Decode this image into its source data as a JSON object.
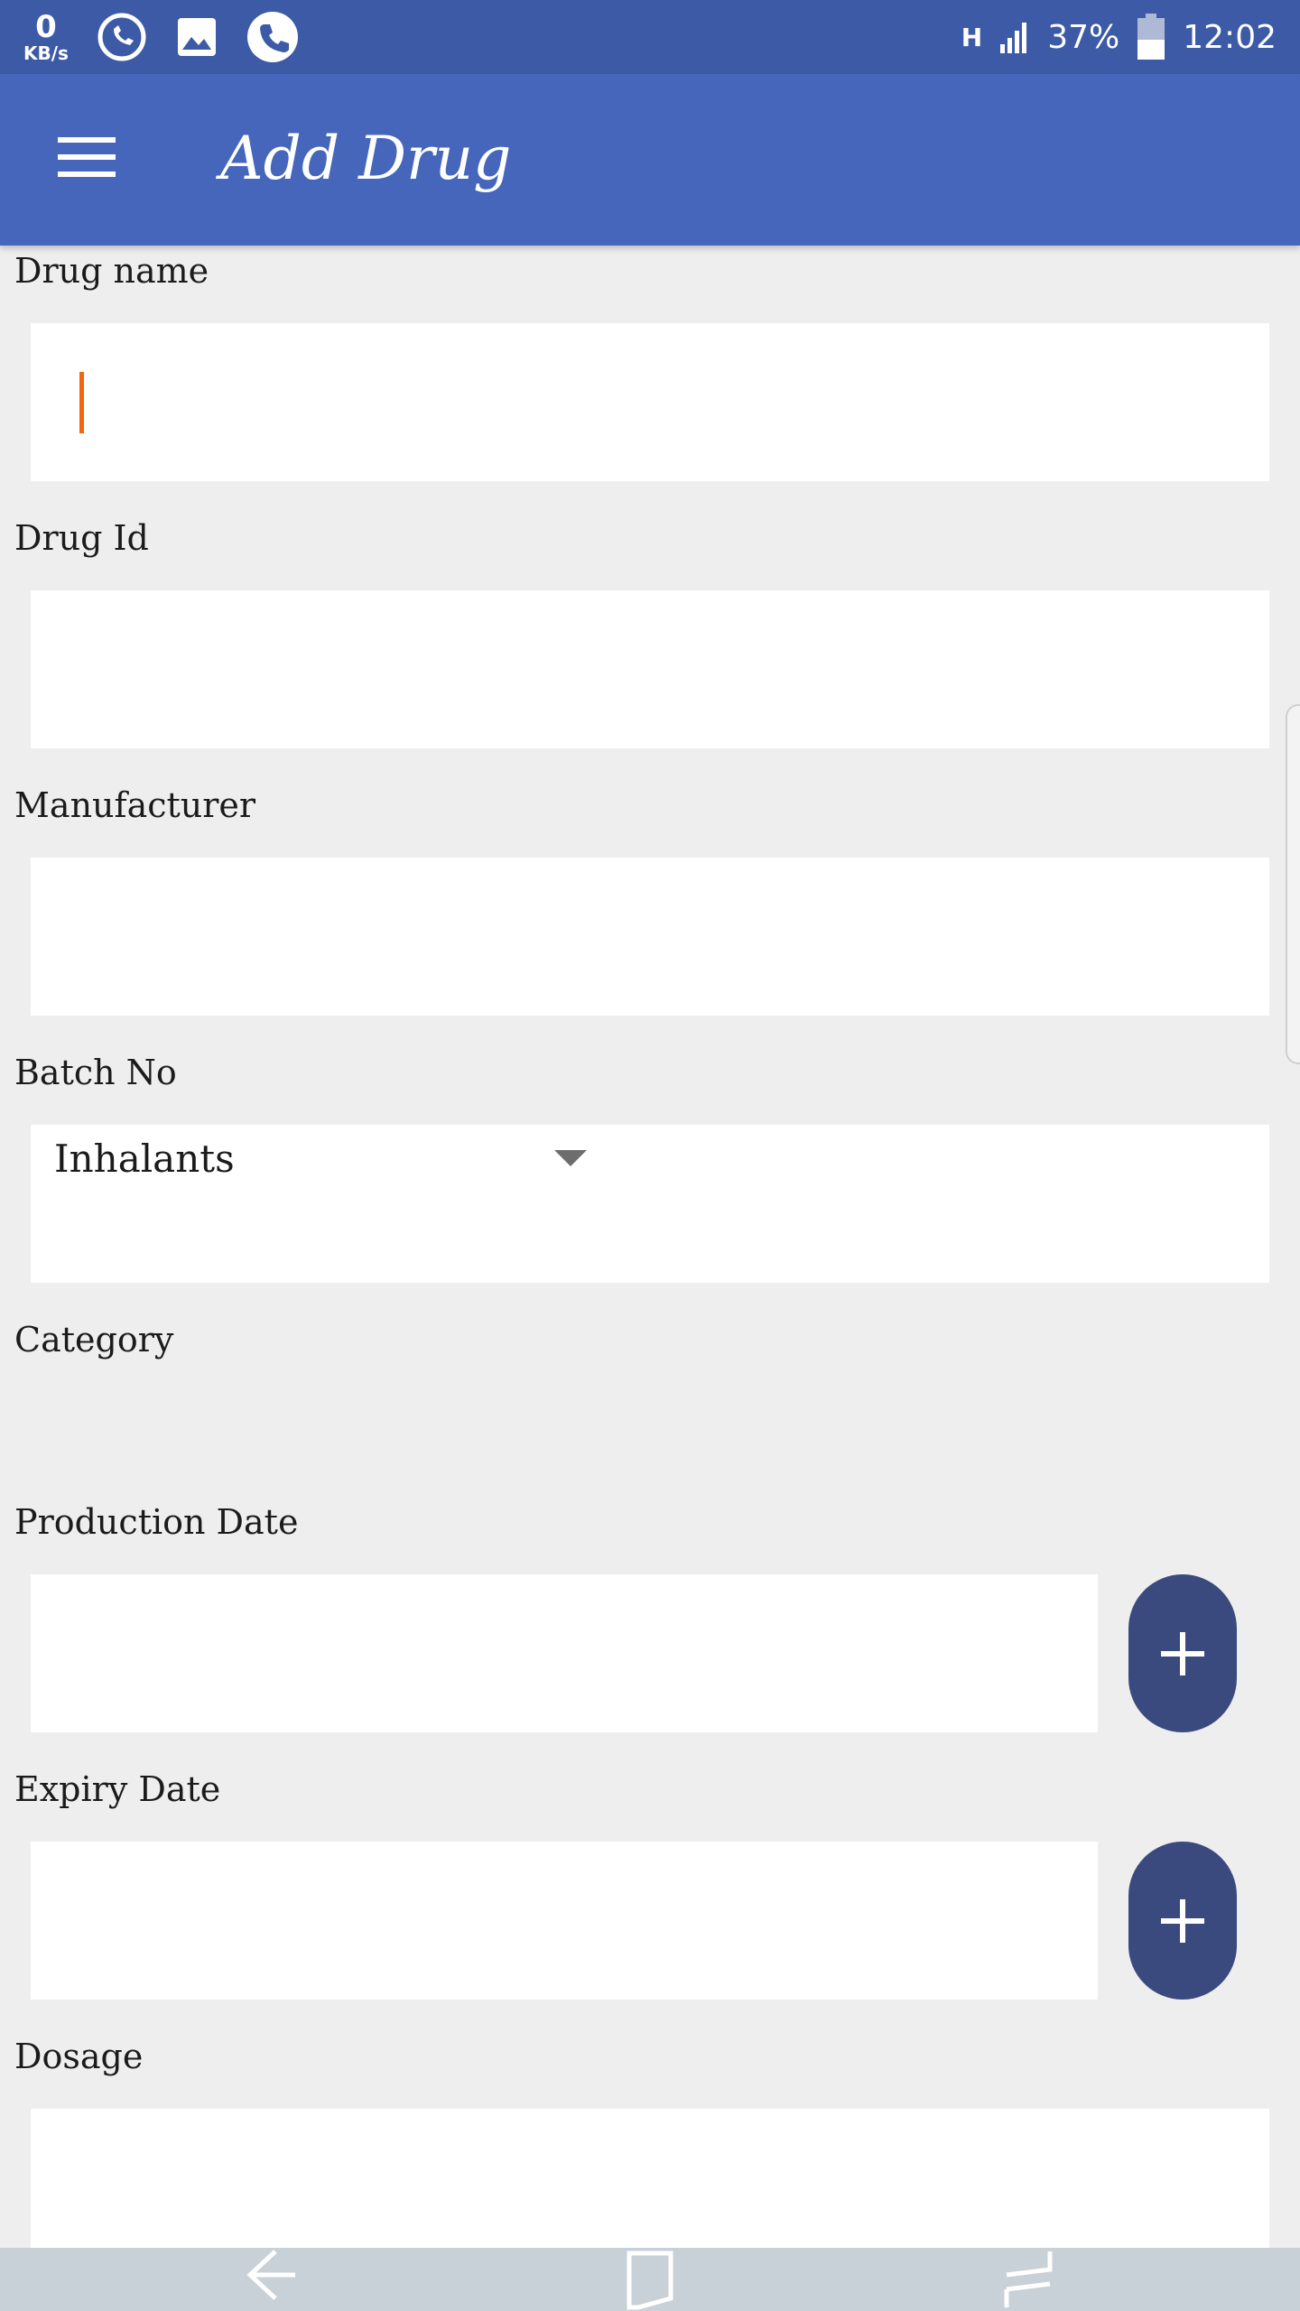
{
  "status_bar": {
    "speed_value": "0",
    "speed_unit": "KB/s",
    "network": "H",
    "battery": "37%",
    "time": "12:02",
    "icons": [
      "whatsapp-icon",
      "gallery-icon",
      "phone-icon",
      "signal-icon",
      "battery-icon"
    ]
  },
  "app_bar": {
    "title": "Add Drug"
  },
  "form": {
    "drug_name": {
      "label": "Drug name",
      "value": ""
    },
    "drug_id": {
      "label": "Drug Id",
      "value": ""
    },
    "manufacturer": {
      "label": "Manufacturer",
      "value": ""
    },
    "batch_no": {
      "label": "Batch No",
      "value": ""
    },
    "category": {
      "label": "Category",
      "selected": "Inhalants"
    },
    "production_date": {
      "label": "Production Date",
      "value": ""
    },
    "expiry_date": {
      "label": "Expiry Date",
      "value": ""
    },
    "dosage": {
      "label": "Dosage",
      "value": ""
    }
  },
  "colors": {
    "status_bar": "#3d5aa6",
    "app_bar": "#4566bb",
    "button": "#3a4a7e",
    "caret": "#f0670f",
    "background": "#eeeeee"
  }
}
